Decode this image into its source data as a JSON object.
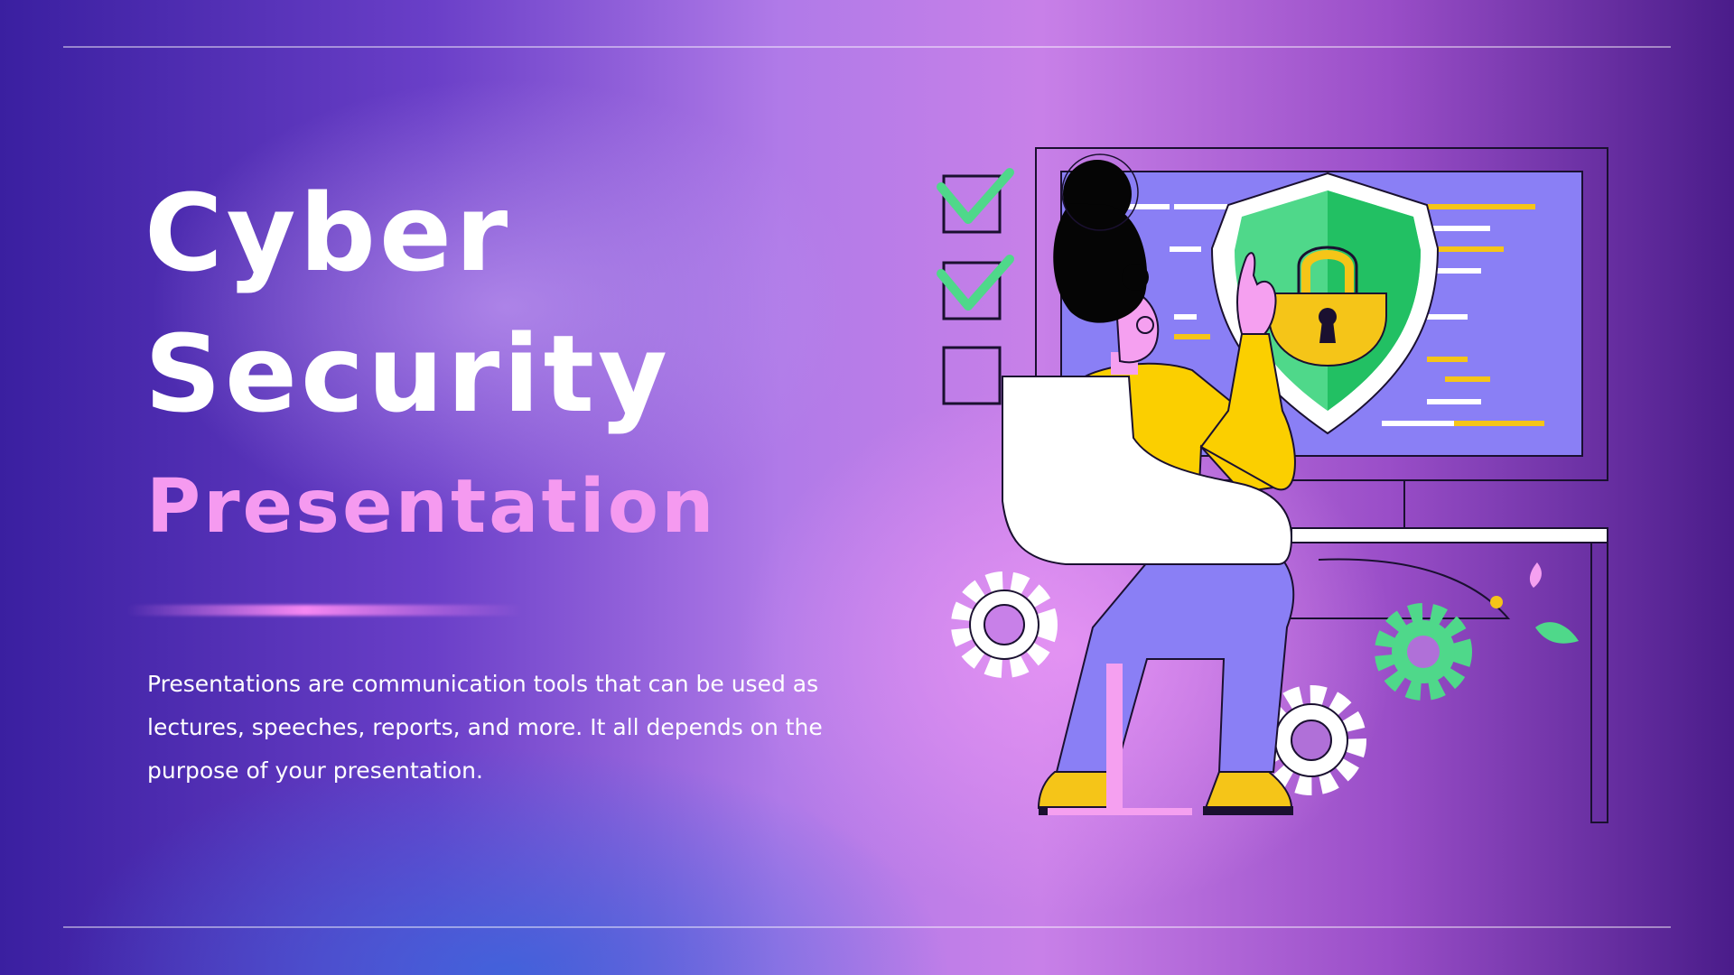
{
  "slide": {
    "title_line1": "Cyber",
    "title_line2": "Security",
    "subtitle": "Presentation",
    "description": "Presentations are communication tools that can be used as lectures, speeches, reports, and more. It all depends on the purpose of your presentation."
  },
  "colors": {
    "title": "#ffffff",
    "subtitle": "#f59af0",
    "shield_green": "#4fd88a",
    "lock_yellow": "#f5c518",
    "monitor_screen": "#8a7ff5",
    "check_green": "#4fd88a"
  },
  "illustration": {
    "icons": [
      "checkbox-checked-icon",
      "checkbox-checked-icon",
      "checkbox-empty-icon",
      "shield-lock-icon",
      "gear-icon",
      "gear-icon",
      "gear-icon",
      "leaf-icon"
    ]
  }
}
